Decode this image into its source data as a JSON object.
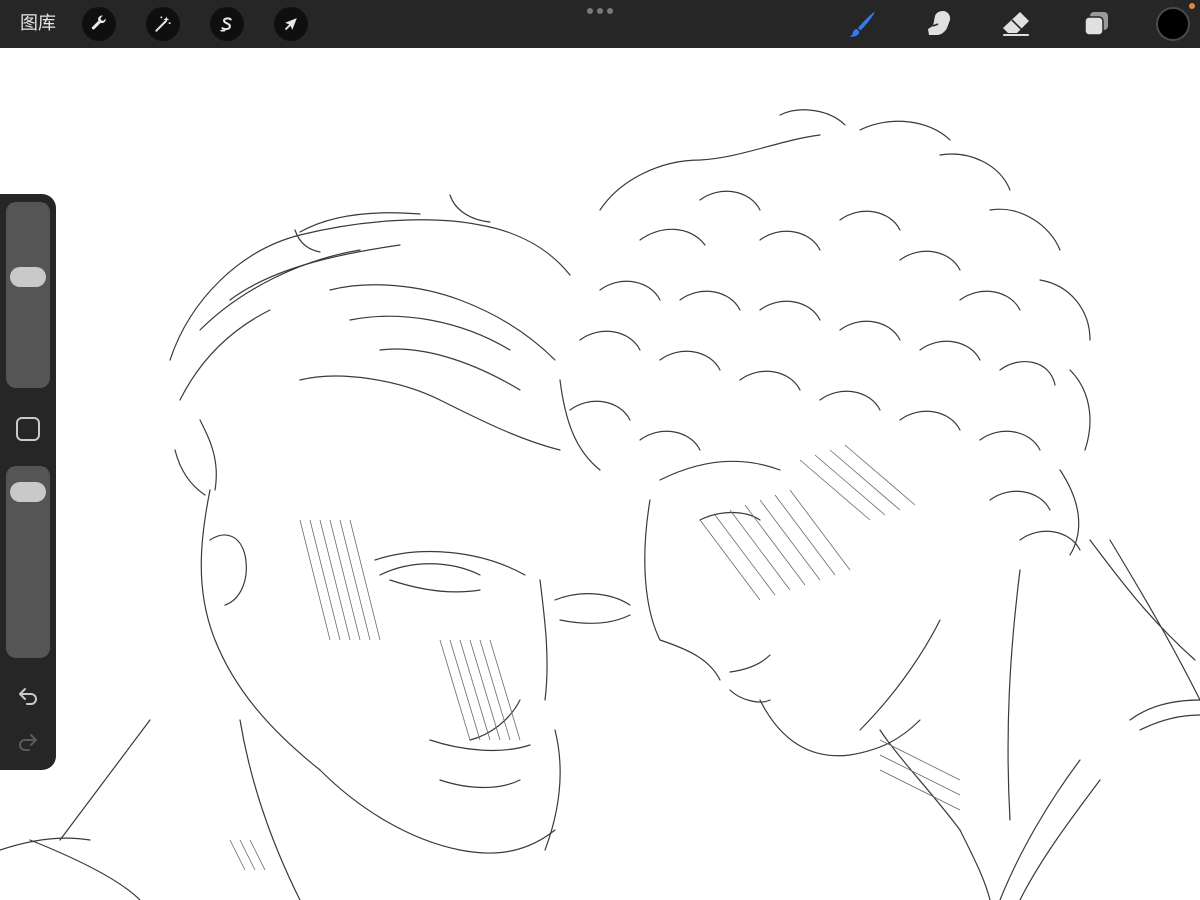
{
  "toolbar": {
    "gallery_label": "图库",
    "left_tools": [
      {
        "name": "actions",
        "icon": "wrench-icon"
      },
      {
        "name": "adjustments",
        "icon": "magic-wand-icon"
      },
      {
        "name": "selection",
        "icon": "selection-s-icon"
      },
      {
        "name": "transform",
        "icon": "arrow-cursor-icon"
      }
    ],
    "right_tools": [
      {
        "name": "brush",
        "icon": "brush-icon",
        "active": true
      },
      {
        "name": "smudge",
        "icon": "smudge-finger-icon",
        "active": false
      },
      {
        "name": "eraser",
        "icon": "eraser-icon",
        "active": false
      },
      {
        "name": "layers",
        "icon": "layers-icon",
        "active": false
      }
    ],
    "current_color": "#000000",
    "accent_color": "#2f7bf5"
  },
  "sidebar": {
    "brush_size_level": 0.62,
    "opacity_level": 0.95,
    "modify_icon": "square-modify-icon",
    "undo_icon": "undo-arrow-icon",
    "redo_icon": "redo-arrow-icon"
  },
  "canvas": {
    "content": "pencil sketch",
    "background": "#ffffff"
  }
}
